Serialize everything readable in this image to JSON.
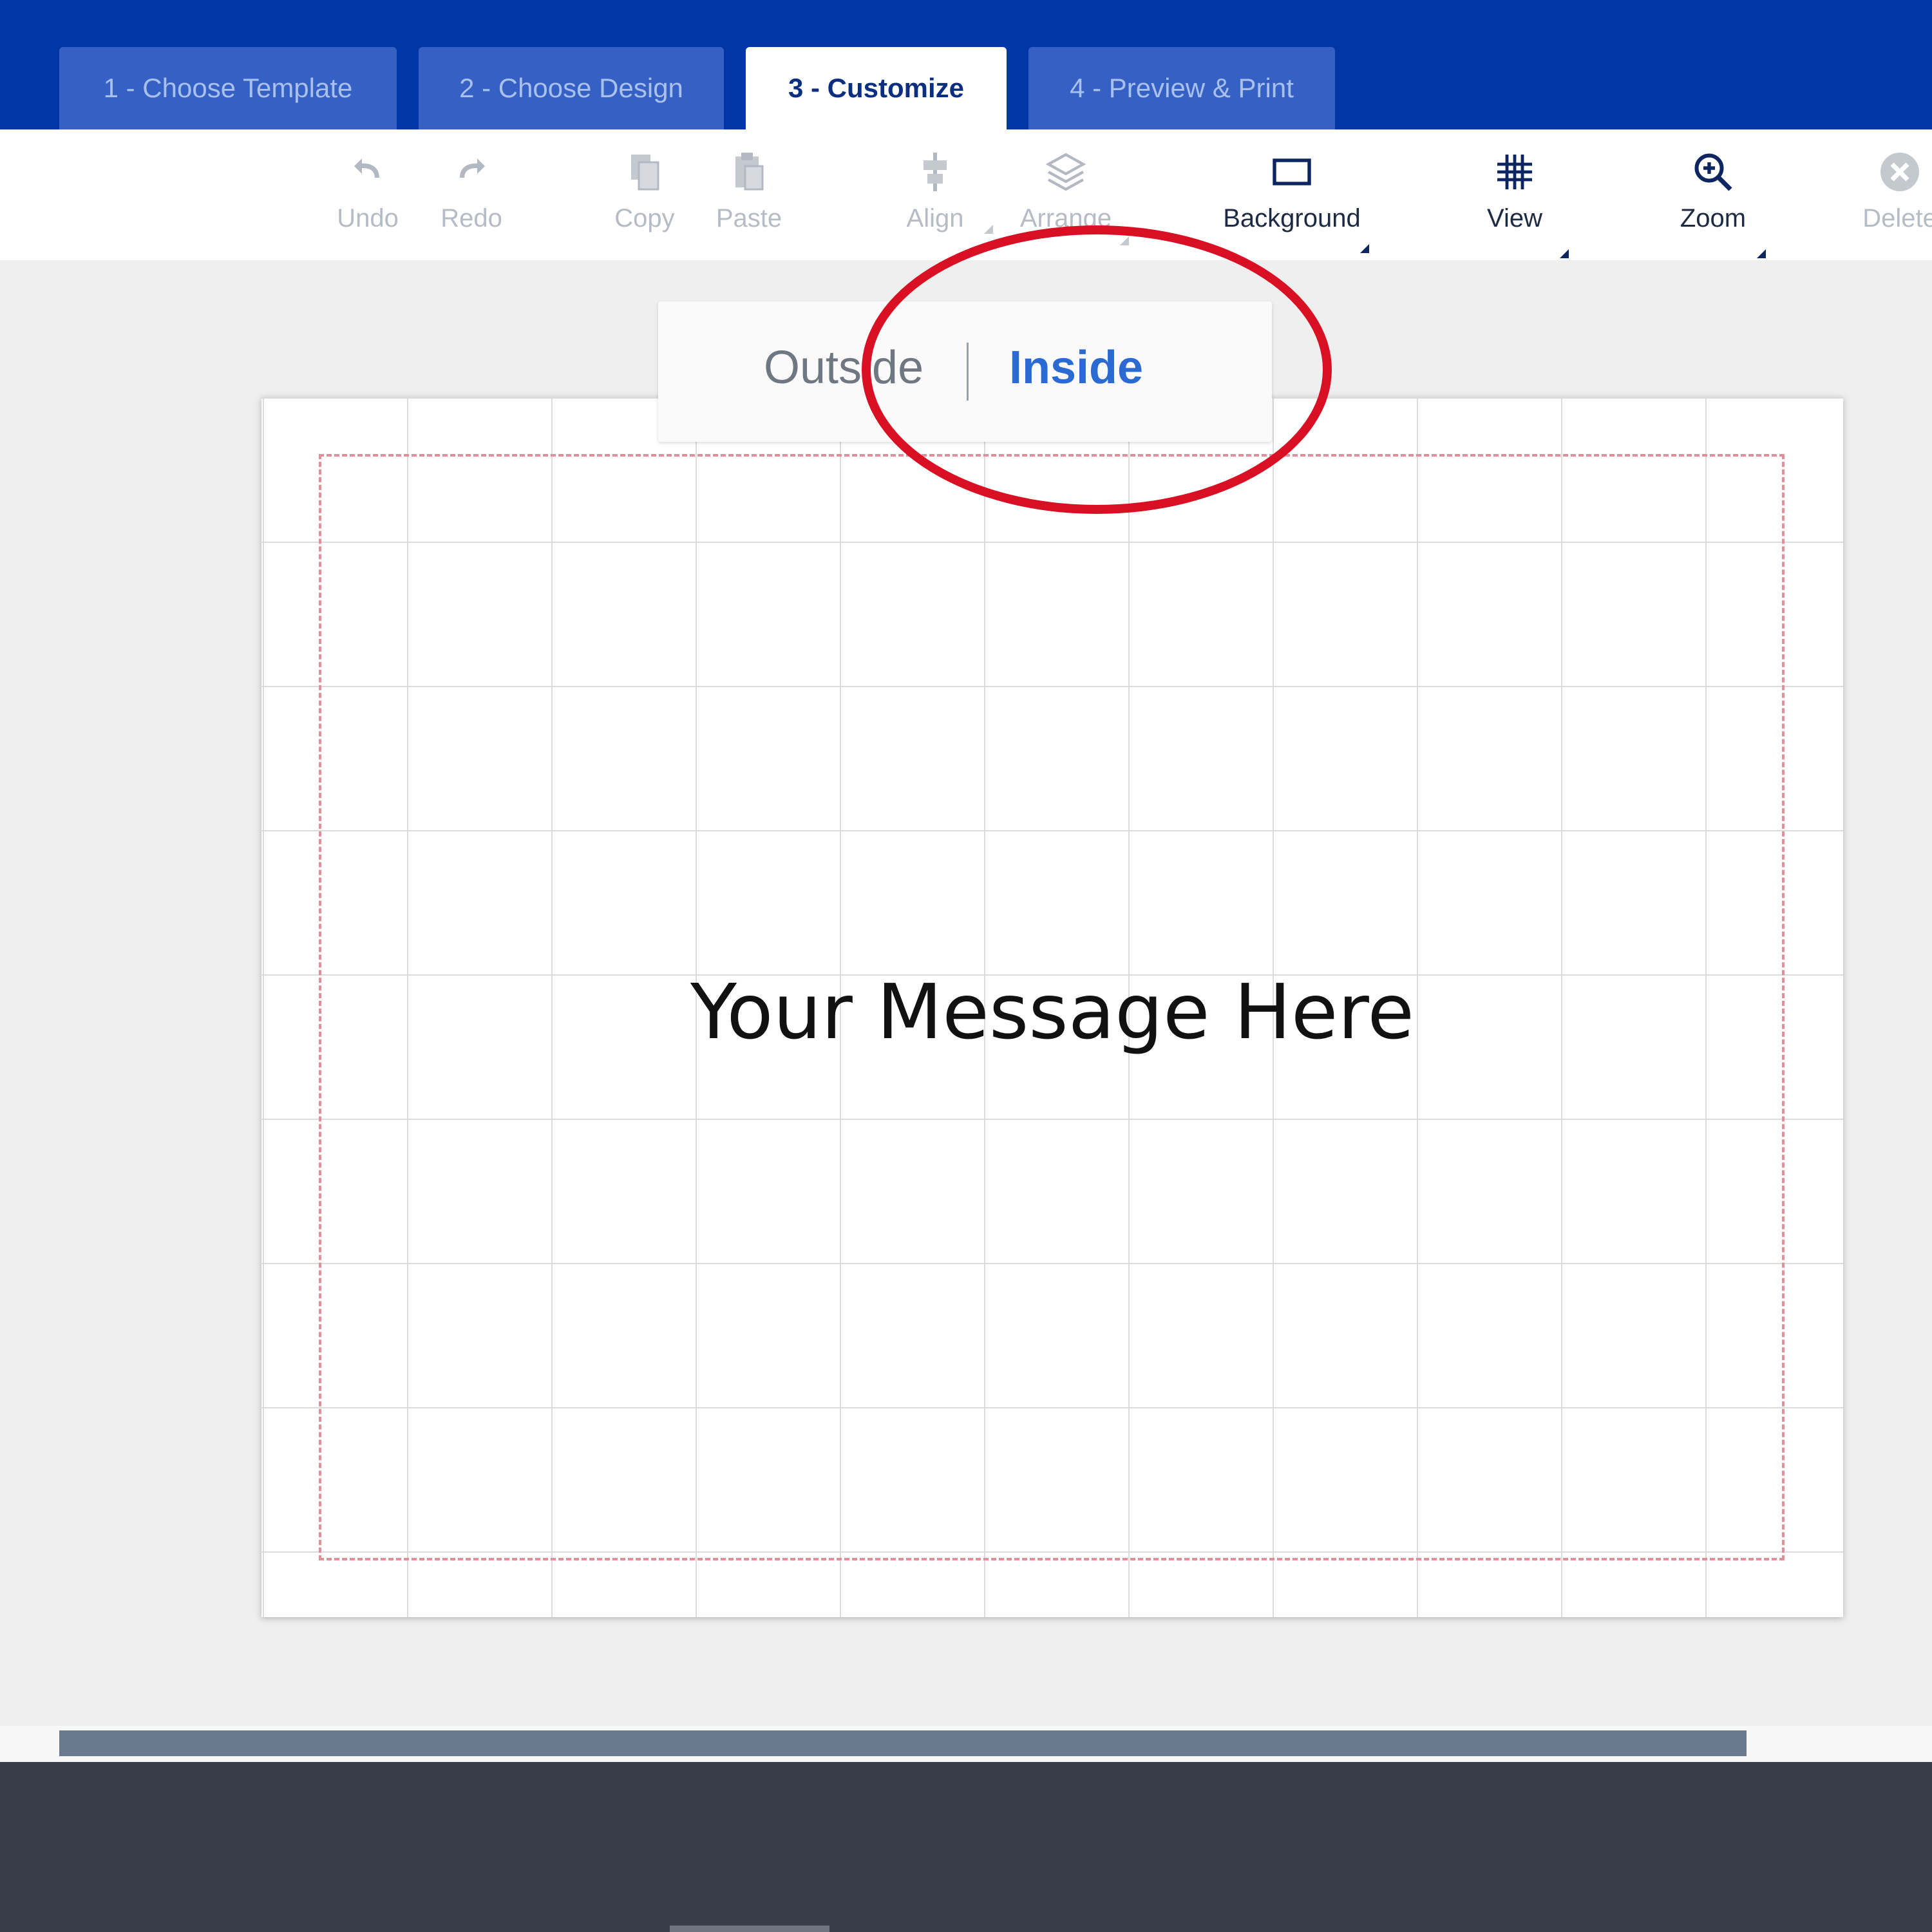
{
  "tabs": [
    {
      "label": "1 - Choose Template",
      "active": false
    },
    {
      "label": "2 - Choose Design",
      "active": false
    },
    {
      "label": "3 - Customize",
      "active": true
    },
    {
      "label": "4 - Preview & Print",
      "active": false
    }
  ],
  "toolbar": {
    "undo": "Undo",
    "redo": "Redo",
    "copy": "Copy",
    "paste": "Paste",
    "align": "Align",
    "arrange": "Arrange",
    "background": "Background",
    "view": "View",
    "zoom": "Zoom",
    "delete": "Delete"
  },
  "side_toggle": {
    "outside": "Outside",
    "inside": "Inside",
    "selected": "Inside"
  },
  "canvas": {
    "message": "Your Message Here"
  },
  "colors": {
    "header_blue": "#0036a5",
    "active_side": "#2c6ad3",
    "annotation_red": "#d90f23",
    "safe_area": "#e0909a"
  }
}
